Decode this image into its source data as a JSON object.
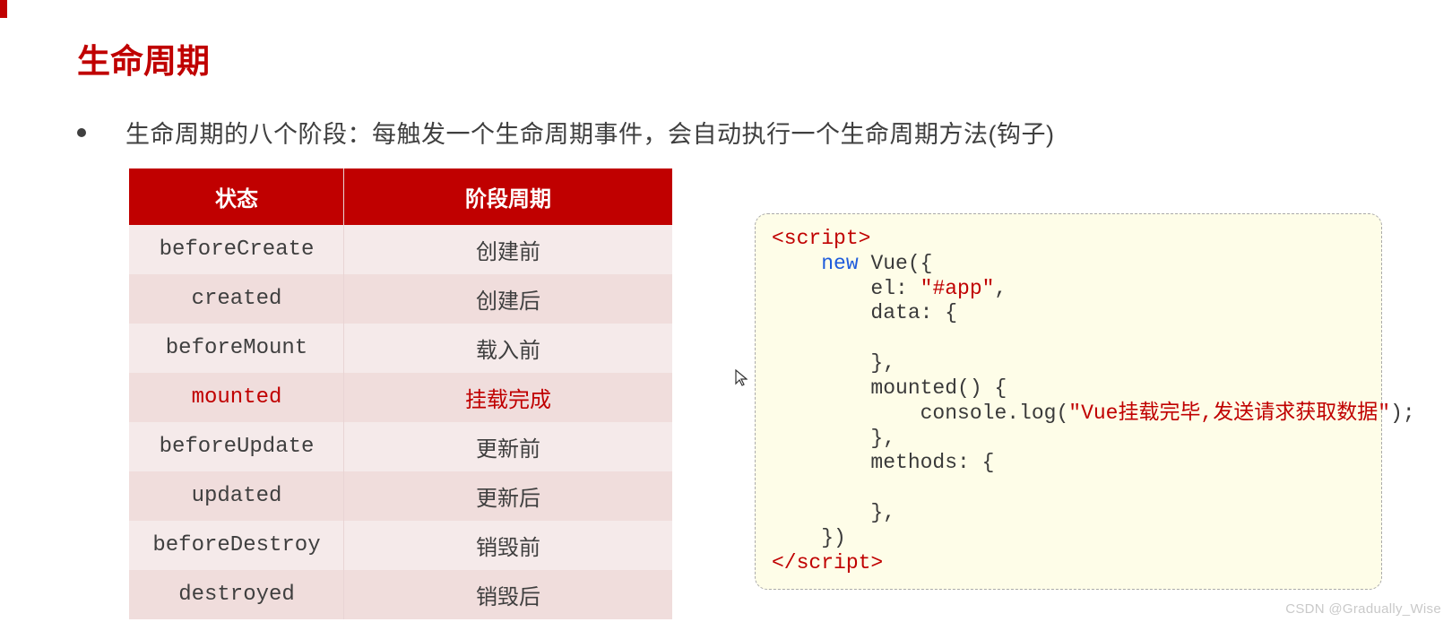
{
  "title": "生命周期",
  "bullet": "生命周期的八个阶段：每触发一个生命周期事件，会自动执行一个生命周期方法(钩子)",
  "table": {
    "headers": [
      "状态",
      "阶段周期"
    ],
    "rows": [
      {
        "state": "beforeCreate",
        "phase": "创建前",
        "highlight": false
      },
      {
        "state": "created",
        "phase": "创建后",
        "highlight": false
      },
      {
        "state": "beforeMount",
        "phase": "载入前",
        "highlight": false
      },
      {
        "state": "mounted",
        "phase": "挂载完成",
        "highlight": true
      },
      {
        "state": "beforeUpdate",
        "phase": "更新前",
        "highlight": false
      },
      {
        "state": "updated",
        "phase": "更新后",
        "highlight": false
      },
      {
        "state": "beforeDestroy",
        "phase": "销毁前",
        "highlight": false
      },
      {
        "state": "destroyed",
        "phase": "销毁后",
        "highlight": false
      }
    ]
  },
  "code": {
    "lines": [
      [
        {
          "t": "<script>",
          "c": "tag"
        }
      ],
      [
        {
          "t": "    ",
          "c": ""
        },
        {
          "t": "new",
          "c": "kw"
        },
        {
          "t": " Vue({",
          "c": ""
        }
      ],
      [
        {
          "t": "        el: ",
          "c": ""
        },
        {
          "t": "\"#app\"",
          "c": "str"
        },
        {
          "t": ",",
          "c": ""
        }
      ],
      [
        {
          "t": "        data: {",
          "c": ""
        }
      ],
      [
        {
          "t": "",
          "c": ""
        }
      ],
      [
        {
          "t": "        },",
          "c": ""
        }
      ],
      [
        {
          "t": "        mounted() {",
          "c": ""
        }
      ],
      [
        {
          "t": "            console.log(",
          "c": ""
        },
        {
          "t": "\"Vue挂载完毕,发送请求获取数据\"",
          "c": "str"
        },
        {
          "t": ");",
          "c": ""
        }
      ],
      [
        {
          "t": "        },",
          "c": ""
        }
      ],
      [
        {
          "t": "        methods: {",
          "c": ""
        }
      ],
      [
        {
          "t": "",
          "c": ""
        }
      ],
      [
        {
          "t": "        },",
          "c": ""
        }
      ],
      [
        {
          "t": "    })",
          "c": ""
        }
      ],
      [
        {
          "t": "</script>",
          "c": "tag"
        }
      ]
    ]
  },
  "cursor": "↖",
  "watermark": "CSDN @Gradually_Wise"
}
